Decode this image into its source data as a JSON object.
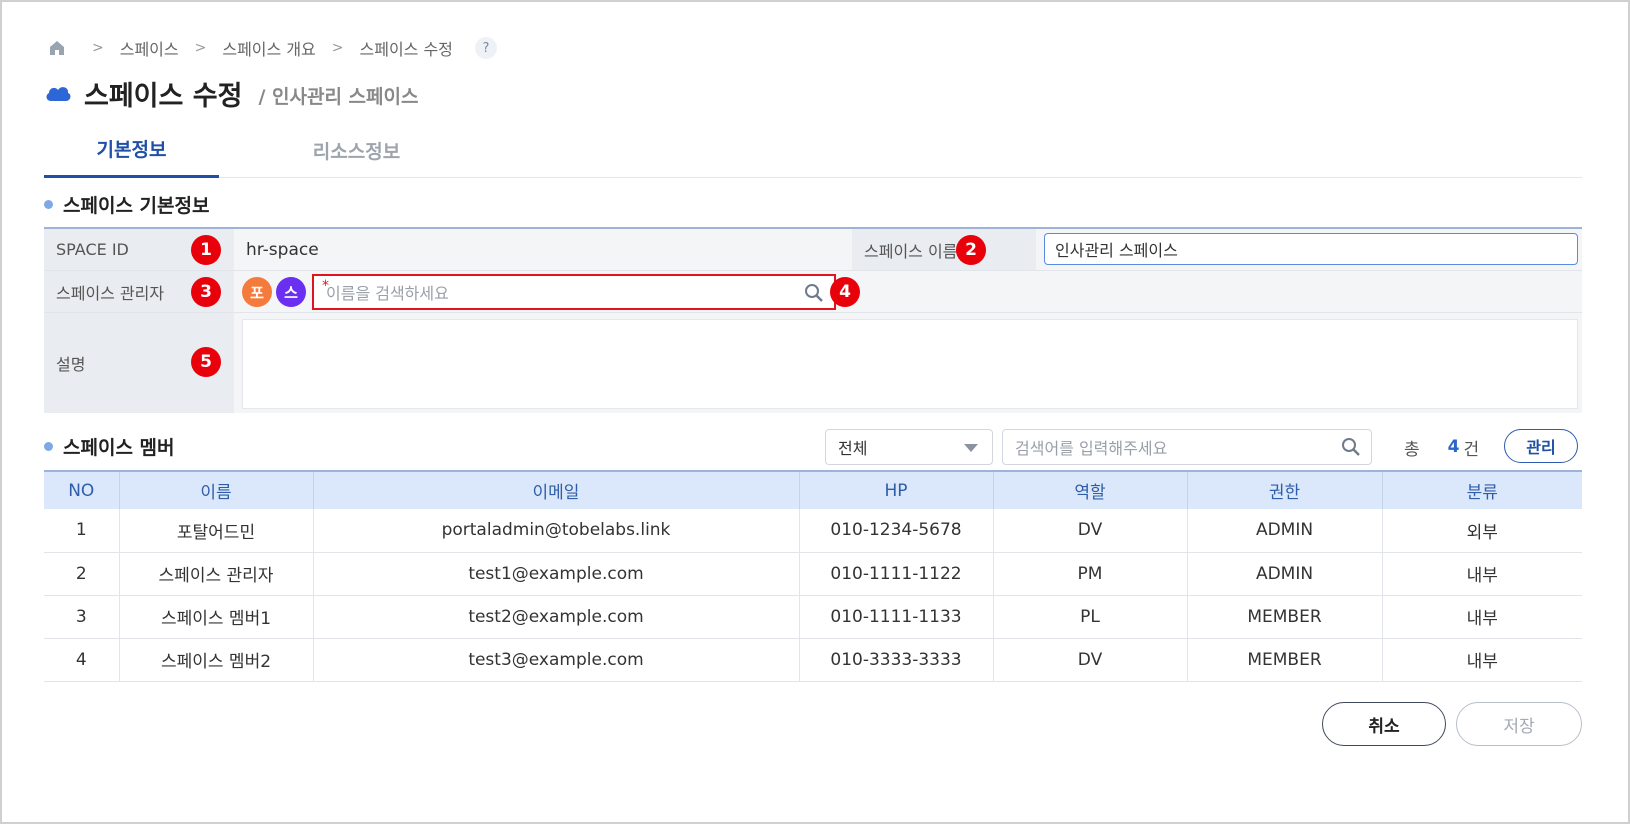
{
  "breadcrumb": {
    "items": [
      "스페이스",
      "스페이스 개요",
      "스페이스 수정"
    ],
    "help": "?"
  },
  "header": {
    "title": "스페이스 수정",
    "subtitle": "/ 인사관리 스페이스"
  },
  "tabs": [
    {
      "label": "기본정보",
      "active": true
    },
    {
      "label": "리소스정보",
      "active": false
    }
  ],
  "basic_info": {
    "section_title": "스페이스 기본정보",
    "space_id_label": "SPACE ID",
    "space_id_value": "hr-space",
    "space_name_label": "스페이스 이름",
    "space_name_value": "인사관리 스페이스",
    "manager_label": "스페이스 관리자",
    "manager_avatars": [
      "포",
      "스"
    ],
    "manager_required": "*",
    "manager_search_placeholder": "이름을 검색하세요",
    "description_label": "설명",
    "description_value": "",
    "markers": [
      "1",
      "2",
      "3",
      "4",
      "5"
    ]
  },
  "members": {
    "section_title": "스페이스 멤버",
    "filter_value": "전체",
    "search_placeholder": "검색어를 입력해주세요",
    "total_prefix": "총",
    "total_count": "4",
    "total_suffix": "건",
    "manage_label": "관리",
    "columns": [
      "NO",
      "이름",
      "이메일",
      "HP",
      "역할",
      "권한",
      "분류"
    ],
    "rows": [
      [
        "1",
        "포탈어드민",
        "portaladmin@tobelabs.link",
        "010-1234-5678",
        "DV",
        "ADMIN",
        "외부"
      ],
      [
        "2",
        "스페이스 관리자",
        "test1@example.com",
        "010-1111-1122",
        "PM",
        "ADMIN",
        "내부"
      ],
      [
        "3",
        "스페이스 멤버1",
        "test2@example.com",
        "010-1111-1133",
        "PL",
        "MEMBER",
        "내부"
      ],
      [
        "4",
        "스페이스 멤버2",
        "test3@example.com",
        "010-3333-3333",
        "DV",
        "MEMBER",
        "내부"
      ]
    ]
  },
  "actions": {
    "cancel_label": "취소",
    "save_label": "저장"
  },
  "colors": {
    "accent": "#1f4fa6",
    "marker_red": "#e8000b",
    "avatar_orange": "#f47b3b",
    "avatar_purple": "#6a2ff0"
  }
}
